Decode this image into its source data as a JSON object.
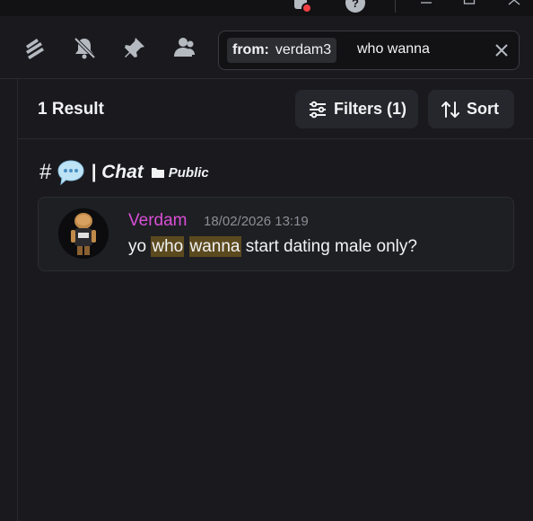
{
  "titlebar": {
    "icons": [
      "inbox-icon",
      "help-icon",
      "minimize-icon",
      "maximize-icon",
      "close-icon"
    ]
  },
  "header": {
    "icons": [
      "threads-icon",
      "notifications-muted-icon",
      "pinned-icon",
      "members-icon"
    ],
    "search": {
      "filter_key": "from:",
      "filter_value": "verdam3",
      "query": "who wanna"
    }
  },
  "results": {
    "count_label": "1 Result",
    "filters_label": "Filters (1)",
    "sort_label": "Sort"
  },
  "channel": {
    "hash": "#",
    "name": "| Chat",
    "tag": "Public"
  },
  "message": {
    "author": "Verdam",
    "timestamp": "18/02/2026 13:19",
    "text_before": "yo ",
    "match_1": "who",
    "space": " ",
    "match_2": "wanna",
    "text_after": " start dating male only?"
  },
  "colors": {
    "background": "#1a1a1e",
    "author": "#d94fd6",
    "highlight": "#5c4a1f",
    "notification_dot": "#f23f43"
  }
}
